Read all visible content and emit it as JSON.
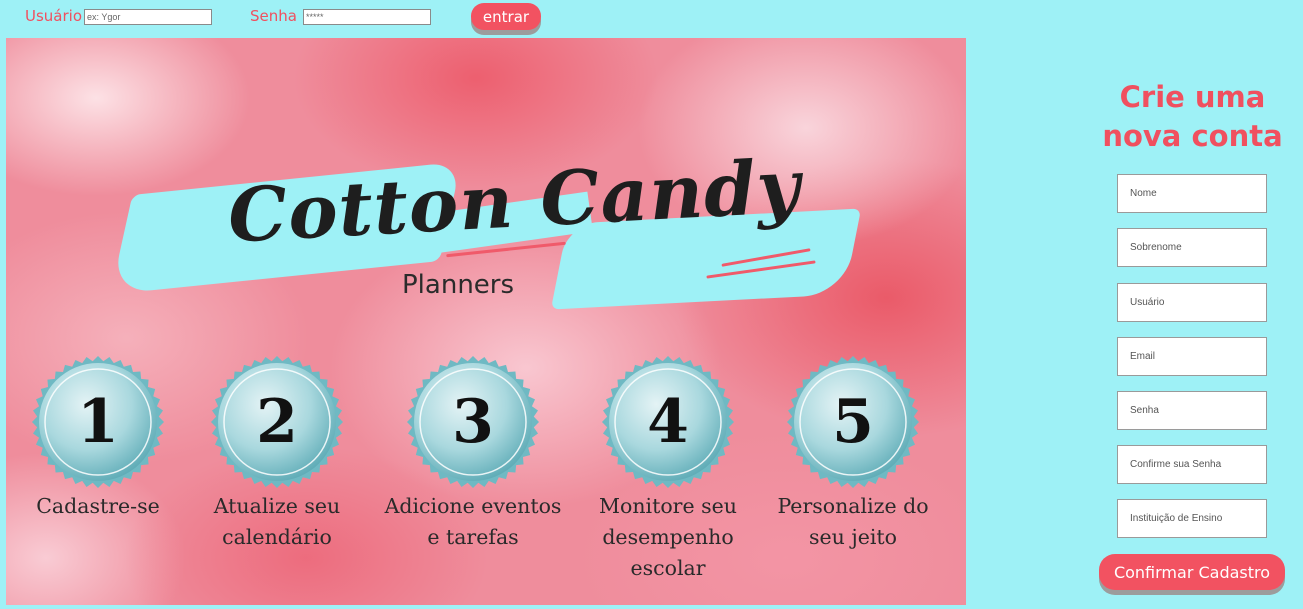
{
  "login": {
    "user_label": "Usuário",
    "user_placeholder": "ex: Ygor",
    "password_label": "Senha",
    "password_placeholder": "*****",
    "enter_label": "entrar"
  },
  "hero": {
    "logo_title": "Cotton Candy",
    "logo_subtitle": "Planners",
    "steps": [
      {
        "number": "1",
        "label": "Cadastre-se"
      },
      {
        "number": "2",
        "label": "Atualize seu\ncalendário"
      },
      {
        "number": "3",
        "label": "Adicione eventos\ne tarefas"
      },
      {
        "number": "4",
        "label": "Monitore seu\ndesempenho\nescolar"
      },
      {
        "number": "5",
        "label": "Personalize do\nseu jeito"
      }
    ]
  },
  "signup": {
    "title": "Crie uma\nnova conta",
    "fields": [
      {
        "placeholder": "Nome"
      },
      {
        "placeholder": "Sobrenome"
      },
      {
        "placeholder": "Usuário"
      },
      {
        "placeholder": "Email"
      },
      {
        "placeholder": "Senha"
      },
      {
        "placeholder": "Confirme sua Senha"
      },
      {
        "placeholder": "Instituição de Ensino"
      }
    ],
    "confirm_label": "Confirmar Cadastro"
  },
  "colors": {
    "background": "#9ef1f6",
    "accent": "#f25261",
    "accent_text": "#f0505f"
  }
}
